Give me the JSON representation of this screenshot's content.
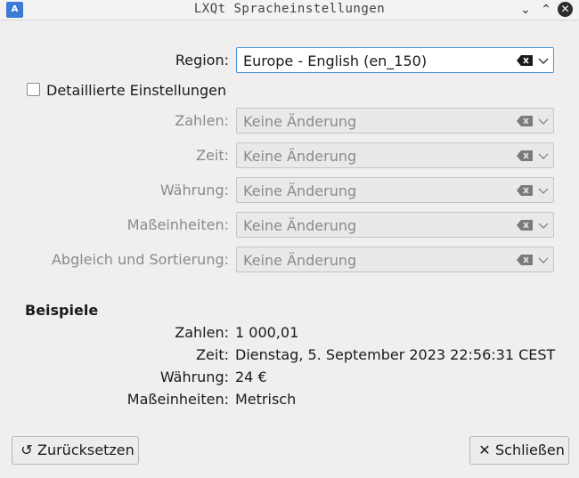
{
  "window": {
    "title": "LXQt Spracheinstellungen",
    "icon": "A",
    "minimize_icon": "⌄",
    "maximize_icon": "⌃",
    "close_icon": "✕"
  },
  "region": {
    "label": "Region:",
    "value": "Europe - English (en_150)"
  },
  "detailed": {
    "label": "Detaillierte Einstellungen",
    "checked": false
  },
  "settings": [
    {
      "label": "Zahlen:",
      "value": "Keine Änderung"
    },
    {
      "label": "Zeit:",
      "value": "Keine Änderung"
    },
    {
      "label": "Währung:",
      "value": "Keine Änderung"
    },
    {
      "label": "Maßeinheiten:",
      "value": "Keine Änderung"
    },
    {
      "label": "Abgleich und Sortierung:",
      "value": "Keine Änderung"
    }
  ],
  "examples": {
    "title": "Beispiele",
    "rows": [
      {
        "label": "Zahlen:",
        "value": "1 000,01"
      },
      {
        "label": "Zeit:",
        "value": "Dienstag, 5. September 2023 22:56:31 CEST"
      },
      {
        "label": "Währung:",
        "value": "24 €"
      },
      {
        "label": "Maßeinheiten:",
        "value": "Metrisch"
      }
    ]
  },
  "buttons": {
    "reset": {
      "label": "Zurücksetzen",
      "icon": "↺"
    },
    "close": {
      "label": "Schließen",
      "icon": "✕"
    }
  },
  "colors": {
    "accent": "#4a90d9",
    "disabled_text": "#8a8a8a"
  }
}
